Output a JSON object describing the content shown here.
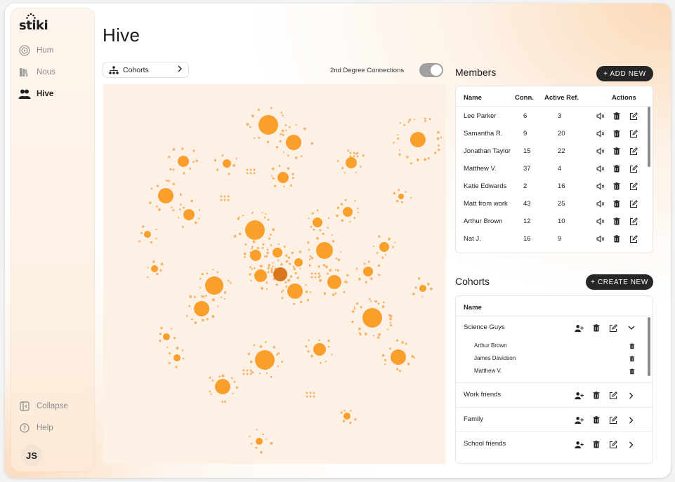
{
  "app": {
    "logo_text": "stiki"
  },
  "sidebar": {
    "items": [
      {
        "label": "Hum",
        "icon": "hum-icon"
      },
      {
        "label": "Nous",
        "icon": "books-icon"
      },
      {
        "label": "Hive",
        "icon": "people-icon",
        "active": true
      }
    ],
    "collapse_label": "Collapse",
    "help_label": "Help",
    "avatar_initials": "JS"
  },
  "page": {
    "title": "Hive"
  },
  "graph_controls": {
    "cohort_select_label": "Cohorts",
    "second_degree_label": "2nd Degree Connections",
    "second_degree_enabled": true
  },
  "members": {
    "title": "Members",
    "add_button": "+ ADD NEW",
    "columns": [
      "Name",
      "Conn.",
      "Active Ref.",
      "Actions"
    ],
    "rows": [
      {
        "name": "Lee Parker",
        "conn": "6",
        "active": "3"
      },
      {
        "name": "Samantha R.",
        "conn": "9",
        "active": "20"
      },
      {
        "name": "Jonathan Taylor",
        "conn": "15",
        "active": "22"
      },
      {
        "name": "Matthew V.",
        "conn": "37",
        "active": "4"
      },
      {
        "name": "Katie Edwards",
        "conn": "2",
        "active": "16"
      },
      {
        "name": "Matt from work",
        "conn": "43",
        "active": "25"
      },
      {
        "name": "Arthur Brown",
        "conn": "12",
        "active": "10"
      },
      {
        "name": "Nat J.",
        "conn": "16",
        "active": "9"
      }
    ]
  },
  "cohorts": {
    "title": "Cohorts",
    "create_button": "+ CREATE NEW",
    "column": "Name",
    "groups": [
      {
        "name": "Science Guys",
        "expanded": true,
        "members": [
          "Arthur Brown",
          "James Davidson",
          "Matthew V."
        ]
      },
      {
        "name": "Work friends",
        "expanded": false
      },
      {
        "name": "Family",
        "expanded": false
      },
      {
        "name": "School friends",
        "expanded": false
      }
    ]
  },
  "colors": {
    "accent": "#fa9f2c",
    "accent_dark": "#d9751a",
    "graph_bg": "#fdf1e6",
    "pill_bg": "#262626"
  }
}
